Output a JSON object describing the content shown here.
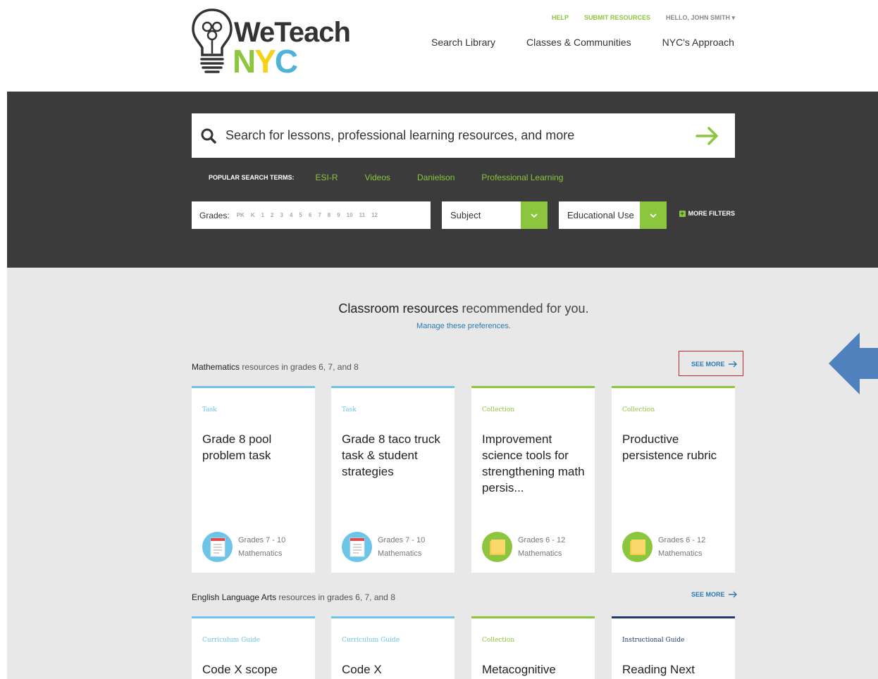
{
  "header": {
    "logo_we": "WeTeach",
    "logo_n": "N",
    "logo_y": "Y",
    "logo_c": "C",
    "util_help": "HELP",
    "util_submit": "SUBMIT RESOURCES",
    "util_user": "HELLO, JOHN SMITH ▾",
    "nav": [
      "Search Library",
      "Classes & Communities",
      "NYC's Approach"
    ]
  },
  "search": {
    "placeholder": "Search for lessons, professional learning resources, and more",
    "popular_label": "POPULAR SEARCH TERMS:",
    "popular_terms": [
      "ESI-R",
      "Videos",
      "Danielson",
      "Professional Learning"
    ]
  },
  "filters": {
    "grades_label": "Grades:",
    "grades": [
      "PK",
      "K",
      "1",
      "2",
      "3",
      "4",
      "5",
      "6",
      "7",
      "8",
      "9",
      "10",
      "11",
      "12"
    ],
    "subject": "Subject",
    "educational_use": "Educational Use",
    "more_filters": "MORE FILTERS"
  },
  "recommended": {
    "title_bold": "Classroom resources",
    "title_rest": " recommended for you.",
    "manage_link": "Manage these preferences."
  },
  "sections": [
    {
      "subject": "Mathematics",
      "rest": " resources in grades 6, 7, and 8",
      "see_more": "SEE MORE",
      "cards": [
        {
          "type": "Task",
          "title": "Grade 8 pool problem task",
          "grades": "Grades 7 - 10",
          "subject": "Mathematics"
        },
        {
          "type": "Task",
          "title": "Grade 8 taco truck task & student strategies",
          "grades": "Grades 7 - 10",
          "subject": "Mathematics"
        },
        {
          "type": "Collection",
          "title": "Improvement science tools for strengthening math persis...",
          "grades": "Grades 6 - 12",
          "subject": "Mathematics"
        },
        {
          "type": "Collection",
          "title": "Productive persistence rubric",
          "grades": "Grades 6 - 12",
          "subject": "Mathematics"
        }
      ]
    },
    {
      "subject": "English Language Arts",
      "rest": " resources in grades 6, 7, and 8",
      "see_more": "SEE MORE",
      "cards": [
        {
          "type": "Curriculum Guide",
          "title": "Code X scope"
        },
        {
          "type": "Curriculum Guide",
          "title": "Code X"
        },
        {
          "type": "Collection",
          "title": "Metacognitive"
        },
        {
          "type": "Instructional Guide",
          "title": "Reading Next"
        }
      ]
    }
  ],
  "colors": {
    "accent_green": "#8cc63f",
    "accent_blue": "#6cc5e8",
    "navy": "#1e3d6b",
    "band": "#3b3b3b",
    "callout_red": "#c0282d",
    "callout_arrow": "#4f81bd"
  }
}
